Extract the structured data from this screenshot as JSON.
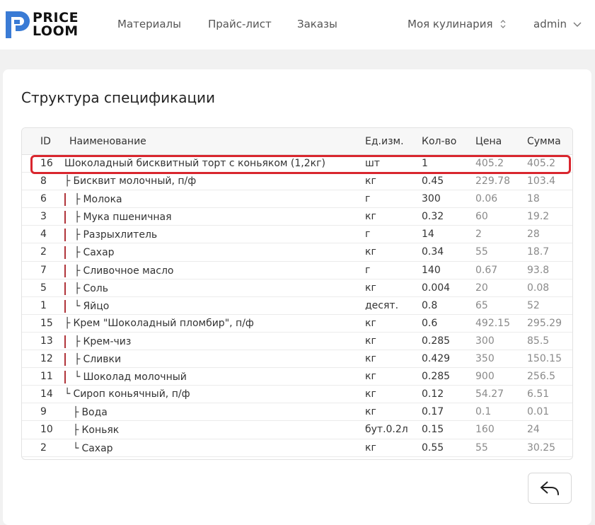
{
  "brand": {
    "line1": "PRICE",
    "line2": "LOOM",
    "mark_color": "#3a7bd5"
  },
  "nav": {
    "materials": "Материалы",
    "pricelist": "Прайс-лист",
    "orders": "Заказы"
  },
  "org": {
    "name": "Моя кулинария",
    "icon": "updown-chevron-icon"
  },
  "user": {
    "name": "admin",
    "icon": "chevron-down-icon"
  },
  "page": {
    "title": "Структура спецификации"
  },
  "table": {
    "headers": {
      "id": "ID",
      "name": "Наименование",
      "unit": "Ед.изм.",
      "qty": "Кол-во",
      "price": "Цена",
      "sum": "Сумма"
    },
    "rows": [
      {
        "id": "16",
        "name": "Шоколадный бисквитный торт с коньяком (1,2кг)",
        "unit": "шт",
        "qty": "1",
        "price": "405.2",
        "sum": "405.2",
        "branch": "",
        "guides": []
      },
      {
        "id": "8",
        "name": "Бисквит молочный, п/ф",
        "unit": "кг",
        "qty": "0.45",
        "price": "229.78",
        "sum": "103.4",
        "branch": "├",
        "guides": []
      },
      {
        "id": "6",
        "name": "Молока",
        "unit": "г",
        "qty": "300",
        "price": "0.06",
        "sum": "18",
        "branch": "├",
        "guides": [
          "red"
        ]
      },
      {
        "id": "3",
        "name": "Мука пшеничная",
        "unit": "кг",
        "qty": "0.32",
        "price": "60",
        "sum": "19.2",
        "branch": "├",
        "guides": [
          "red"
        ]
      },
      {
        "id": "4",
        "name": "Разрыхлитель",
        "unit": "г",
        "qty": "14",
        "price": "2",
        "sum": "28",
        "branch": "├",
        "guides": [
          "red"
        ]
      },
      {
        "id": "2",
        "name": "Сахар",
        "unit": "кг",
        "qty": "0.34",
        "price": "55",
        "sum": "18.7",
        "branch": "├",
        "guides": [
          "red"
        ]
      },
      {
        "id": "7",
        "name": "Сливочное масло",
        "unit": "г",
        "qty": "140",
        "price": "0.67",
        "sum": "93.8",
        "branch": "├",
        "guides": [
          "red"
        ]
      },
      {
        "id": "5",
        "name": "Соль",
        "unit": "кг",
        "qty": "0.004",
        "price": "20",
        "sum": "0.08",
        "branch": "├",
        "guides": [
          "red"
        ]
      },
      {
        "id": "1",
        "name": "Яйцо",
        "unit": "десят.",
        "qty": "0.8",
        "price": "65",
        "sum": "52",
        "branch": "└",
        "guides": [
          "red"
        ]
      },
      {
        "id": "15",
        "name": "Крем \"Шоколадный пломбир\", п/ф",
        "unit": "кг",
        "qty": "0.6",
        "price": "492.15",
        "sum": "295.29",
        "branch": "├",
        "guides": []
      },
      {
        "id": "13",
        "name": "Крем-чиз",
        "unit": "кг",
        "qty": "0.285",
        "price": "300",
        "sum": "85.5",
        "branch": "├",
        "guides": [
          "red"
        ]
      },
      {
        "id": "12",
        "name": "Сливки",
        "unit": "кг",
        "qty": "0.429",
        "price": "350",
        "sum": "150.15",
        "branch": "├",
        "guides": [
          "red"
        ]
      },
      {
        "id": "11",
        "name": "Шоколад молочный",
        "unit": "кг",
        "qty": "0.285",
        "price": "900",
        "sum": "256.5",
        "branch": "└",
        "guides": [
          "red"
        ]
      },
      {
        "id": "14",
        "name": "Сироп коньячный, п/ф",
        "unit": "кг",
        "qty": "0.12",
        "price": "54.27",
        "sum": "6.51",
        "branch": "└",
        "guides": []
      },
      {
        "id": "9",
        "name": "Вода",
        "unit": "кг",
        "qty": "0.17",
        "price": "0.1",
        "sum": "0.01",
        "branch": "├",
        "guides": [
          "blank"
        ]
      },
      {
        "id": "10",
        "name": "Коньяк",
        "unit": "бут.0.2л",
        "qty": "0.15",
        "price": "160",
        "sum": "24",
        "branch": "├",
        "guides": [
          "blank"
        ]
      },
      {
        "id": "2",
        "name": "Сахар",
        "unit": "кг",
        "qty": "0.55",
        "price": "55",
        "sum": "30.25",
        "branch": "└",
        "guides": [
          "blank"
        ]
      }
    ]
  },
  "back_button": {
    "icon": "undo-arrow-icon"
  },
  "colors": {
    "highlight": "#d9262e",
    "guide": "#b0343a",
    "background": "#f1f1f1"
  }
}
